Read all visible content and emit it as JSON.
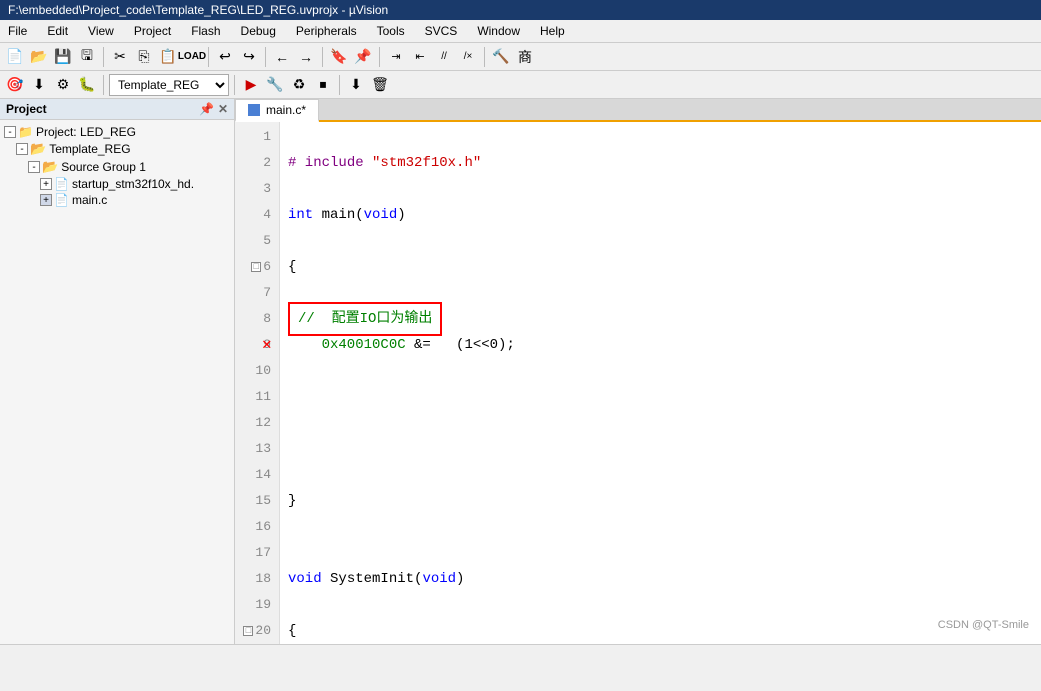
{
  "title_bar": {
    "text": "F:\\embedded\\Project_code\\Template_REG\\LED_REG.uvprojx - µVision"
  },
  "menu": {
    "items": [
      "File",
      "Edit",
      "View",
      "Project",
      "Flash",
      "Debug",
      "Peripherals",
      "Tools",
      "SVCS",
      "Window",
      "Help"
    ]
  },
  "toolbar": {
    "dropdown_value": "Template_REG"
  },
  "project_panel": {
    "title": "Project",
    "tree": [
      {
        "id": "root",
        "label": "Project: LED_REG",
        "level": 0,
        "expand": true,
        "icon": "project"
      },
      {
        "id": "template",
        "label": "Template_REG",
        "level": 1,
        "expand": true,
        "icon": "folder"
      },
      {
        "id": "source",
        "label": "Source Group 1",
        "level": 2,
        "expand": true,
        "icon": "folder"
      },
      {
        "id": "startup",
        "label": "startup_stm32f10x_hd.",
        "level": 3,
        "expand": true,
        "icon": "file-s"
      },
      {
        "id": "mainc",
        "label": "main.c",
        "level": 3,
        "expand": false,
        "icon": "file-c"
      }
    ]
  },
  "editor": {
    "tab": "main.c*",
    "lines": [
      {
        "num": 1,
        "tokens": []
      },
      {
        "num": 2,
        "tokens": [
          {
            "type": "preprocessor",
            "text": "# include "
          },
          {
            "type": "string",
            "text": "\"stm32f10x.h\""
          }
        ]
      },
      {
        "num": 3,
        "tokens": []
      },
      {
        "num": 4,
        "tokens": [
          {
            "type": "keyword-blue",
            "text": "int "
          },
          {
            "type": "normal",
            "text": "main("
          },
          {
            "type": "keyword-blue",
            "text": "void"
          },
          {
            "type": "normal",
            "text": ")"
          }
        ]
      },
      {
        "num": 5,
        "tokens": []
      },
      {
        "num": 6,
        "tokens": [
          {
            "type": "expand",
            "text": "□"
          },
          {
            "type": "normal",
            "text": "{"
          }
        ],
        "expand": true
      },
      {
        "num": 7,
        "tokens": []
      },
      {
        "num": 8,
        "tokens": [
          {
            "type": "comment-boxed",
            "text": "//  配置IO口为输出"
          }
        ]
      },
      {
        "num": 9,
        "tokens": [
          {
            "type": "hex",
            "text": "    0x40010C0C "
          },
          {
            "type": "normal",
            "text": "&="
          },
          {
            "type": "normal",
            "text": "  (1<<0);"
          }
        ],
        "error": true
      },
      {
        "num": 10,
        "tokens": []
      },
      {
        "num": 11,
        "tokens": []
      },
      {
        "num": 12,
        "tokens": []
      },
      {
        "num": 13,
        "tokens": []
      },
      {
        "num": 14,
        "tokens": []
      },
      {
        "num": 15,
        "tokens": [
          {
            "type": "normal",
            "text": "}"
          }
        ]
      },
      {
        "num": 16,
        "tokens": []
      },
      {
        "num": 17,
        "tokens": []
      },
      {
        "num": 18,
        "tokens": [
          {
            "type": "keyword-blue",
            "text": "void "
          },
          {
            "type": "normal",
            "text": "SystemInit("
          },
          {
            "type": "keyword-blue",
            "text": "void"
          },
          {
            "type": "normal",
            "text": ")"
          }
        ]
      },
      {
        "num": 19,
        "tokens": []
      },
      {
        "num": 20,
        "tokens": [
          {
            "type": "expand",
            "text": "□"
          },
          {
            "type": "normal",
            "text": "{"
          }
        ],
        "expand": true
      }
    ]
  },
  "watermark": "CSDN @QT-Smile"
}
